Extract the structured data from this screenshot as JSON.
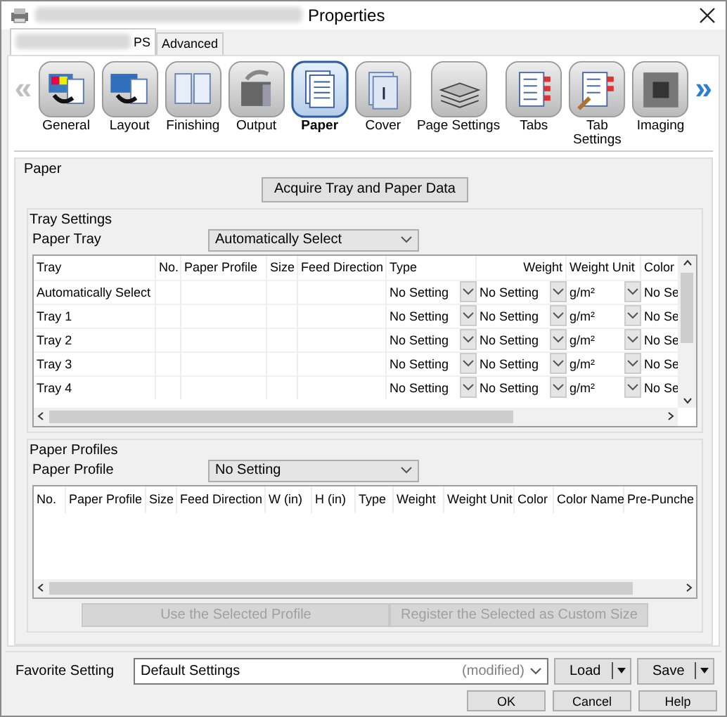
{
  "window": {
    "title": "Properties"
  },
  "tabs": [
    {
      "label": "PS",
      "selected": true
    },
    {
      "label": "Advanced",
      "selected": false
    }
  ],
  "ribbon": {
    "prev": {
      "label": "«",
      "disabled": true
    },
    "next": {
      "label": "»",
      "disabled": false
    },
    "items": [
      {
        "label": "General",
        "kind": "general",
        "selected": false
      },
      {
        "label": "Layout",
        "kind": "layout",
        "selected": false
      },
      {
        "label": "Finishing",
        "kind": "finishing",
        "selected": false
      },
      {
        "label": "Output",
        "kind": "output",
        "selected": false
      },
      {
        "label": "Paper",
        "kind": "paper",
        "selected": true
      },
      {
        "label": "Cover",
        "kind": "cover",
        "selected": false
      },
      {
        "label": "Page Settings",
        "kind": "pages",
        "selected": false
      },
      {
        "label": "Tabs",
        "kind": "tabs",
        "selected": false
      },
      {
        "label": "Tab Settings",
        "kind": "tabsettings",
        "selected": false
      },
      {
        "label": "Imaging",
        "kind": "imaging",
        "selected": false
      }
    ]
  },
  "paper": {
    "title": "Paper",
    "acquire_button": "Acquire Tray and Paper Data",
    "tray_settings": {
      "title": "Tray Settings",
      "paper_tray": {
        "label": "Paper Tray",
        "value": "Automatically Select"
      },
      "table": {
        "columns": [
          "Tray",
          "No.",
          "Paper Profile",
          "Size",
          "Feed Direction",
          "Type",
          "Weight",
          "Weight Unit",
          "Color"
        ],
        "rows": [
          {
            "tray": "Automatically Select",
            "type": "No Setting",
            "weight": "No Setting",
            "weight_unit": "g/m²",
            "paper_color": "No Se"
          },
          {
            "tray": "Tray 1",
            "type": "No Setting",
            "weight": "No Setting",
            "weight_unit": "g/m²",
            "paper_color": "No Se"
          },
          {
            "tray": "Tray 2",
            "type": "No Setting",
            "weight": "No Setting",
            "weight_unit": "g/m²",
            "paper_color": "No Se"
          },
          {
            "tray": "Tray 3",
            "type": "No Setting",
            "weight": "No Setting",
            "weight_unit": "g/m²",
            "paper_color": "No Se"
          },
          {
            "tray": "Tray 4",
            "type": "No Setting",
            "weight": "No Setting",
            "weight_unit": "g/m²",
            "paper_color": "No Se"
          }
        ]
      }
    },
    "paper_profiles": {
      "title": "Paper Profiles",
      "paper_profile": {
        "label": "Paper Profile",
        "value": "No Setting"
      },
      "table": {
        "columns": [
          "No.",
          "Paper Profile",
          "Size",
          "Feed Direction",
          "W (in)",
          "H (in)",
          "Type",
          "Weight",
          "Weight Unit",
          "Color",
          "Color Name",
          "Pre-Punche"
        ]
      },
      "use_button": {
        "label": "Use the Selected Profile",
        "disabled": true
      },
      "register_button": {
        "label": "Register the Selected as Custom Size",
        "disabled": true
      }
    }
  },
  "favorite": {
    "label": "Favorite Setting",
    "value": "Default Settings",
    "note": "(modified)",
    "load": "Load",
    "save": "Save"
  },
  "buttons": [
    "OK",
    "Cancel",
    "Help"
  ]
}
